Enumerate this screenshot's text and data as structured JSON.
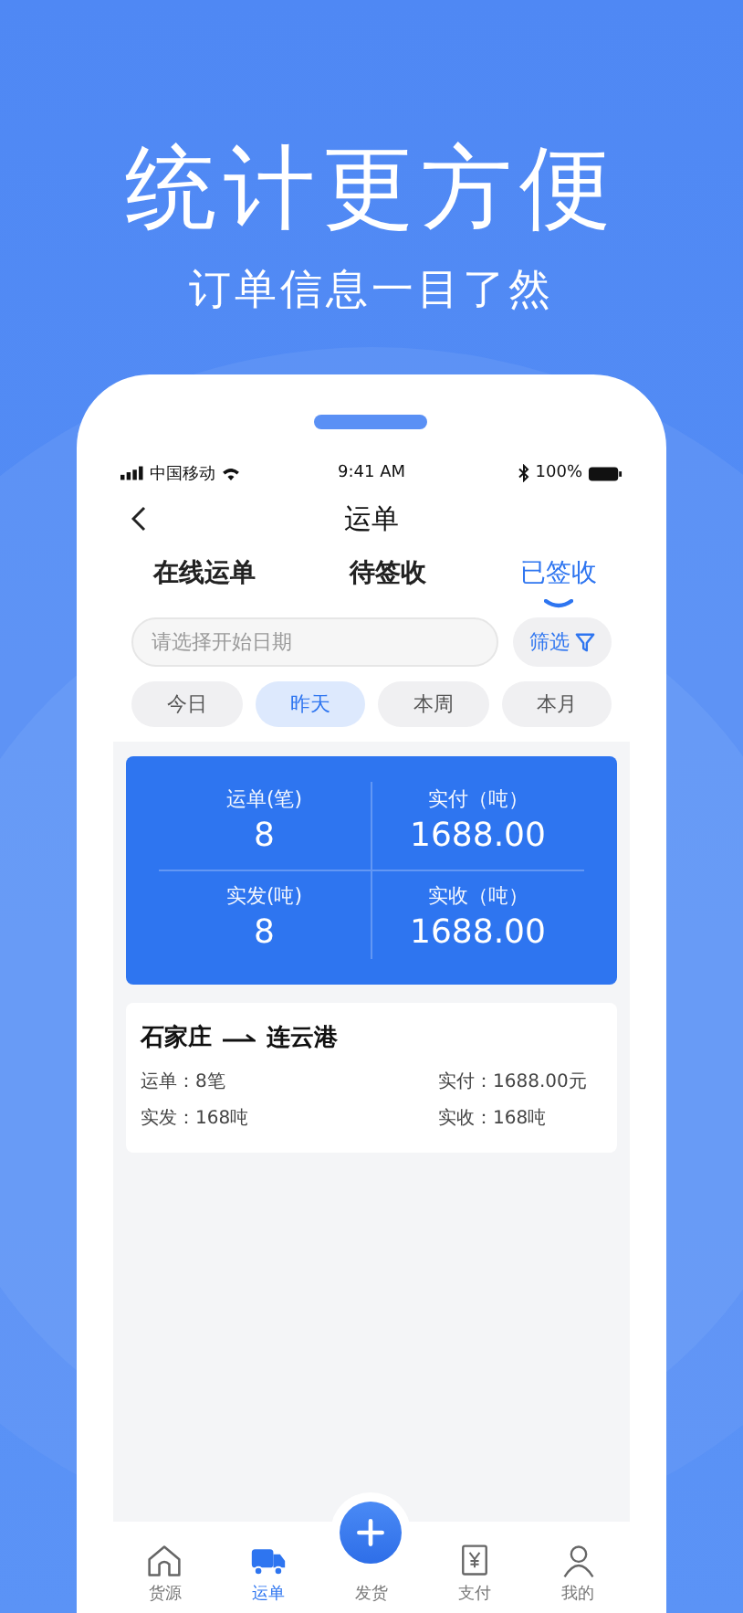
{
  "headline": "统计更方便",
  "subheadline": "订单信息一目了然",
  "status_bar": {
    "carrier": "中国移动",
    "time": "9:41 AM",
    "battery": "100%"
  },
  "nav": {
    "title": "运单"
  },
  "tabs": [
    {
      "label": "在线运单",
      "selected": false
    },
    {
      "label": "待签收",
      "selected": false
    },
    {
      "label": "已签收",
      "selected": true
    }
  ],
  "date_field": {
    "placeholder": "请选择开始日期"
  },
  "filter_button": "筛选",
  "chips": [
    {
      "label": "今日",
      "selected": false
    },
    {
      "label": "昨天",
      "selected": true
    },
    {
      "label": "本周",
      "selected": false
    },
    {
      "label": "本月",
      "selected": false
    }
  ],
  "summary": [
    {
      "label": "运单(笔)",
      "value": "8"
    },
    {
      "label": "实付（吨）",
      "value": "1688.00"
    },
    {
      "label": "实发(吨)",
      "value": "8"
    },
    {
      "label": "实收（吨）",
      "value": "1688.00"
    }
  ],
  "routes": [
    {
      "from": "石家庄",
      "to": "连云港",
      "fields": [
        "运单：8笔",
        "实付：1688.00元",
        "实发：168吨",
        "实收：168吨"
      ]
    }
  ],
  "bottom_nav": [
    {
      "kind": "home",
      "label": "货源",
      "selected": false
    },
    {
      "kind": "truck",
      "label": "运单",
      "selected": true
    },
    {
      "kind": "plus",
      "label": "发货",
      "selected": false
    },
    {
      "kind": "payment",
      "label": "支付",
      "selected": false
    },
    {
      "kind": "user",
      "label": "我的",
      "selected": false
    }
  ]
}
